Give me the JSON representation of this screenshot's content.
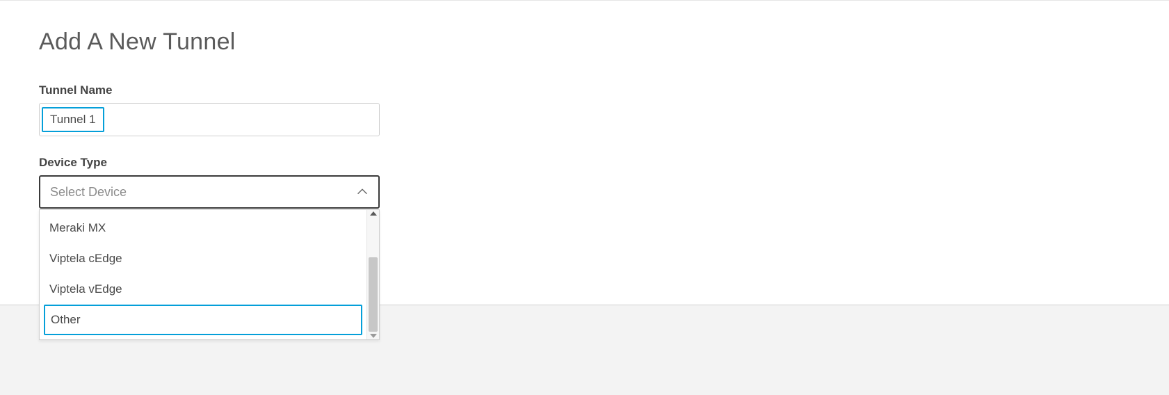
{
  "page": {
    "title": "Add A New Tunnel"
  },
  "tunnelName": {
    "label": "Tunnel Name",
    "value": "Tunnel 1"
  },
  "deviceType": {
    "label": "Device Type",
    "placeholder": "Select Device",
    "expanded": true,
    "options": {
      "0": "Meraki MX",
      "1": "Viptela cEdge",
      "2": "Viptela vEdge",
      "3": "Other"
    },
    "highlightedIndex": 3
  }
}
